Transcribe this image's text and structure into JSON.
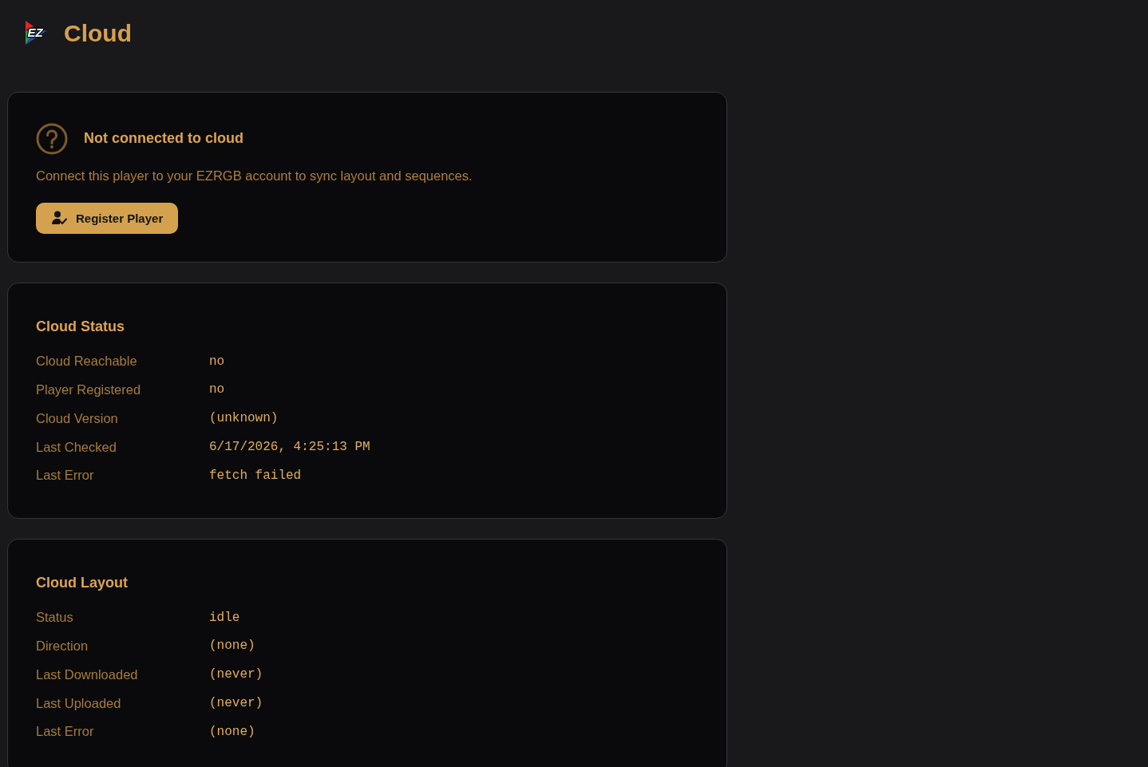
{
  "header": {
    "logo_text": "EZ",
    "title": "Cloud"
  },
  "connection_card": {
    "title": "Not connected to cloud",
    "description": "Connect this player to your EZRGB account to sync layout and sequences.",
    "button": "Register Player"
  },
  "sections": [
    {
      "title": "Cloud Status",
      "rows": [
        {
          "label": "Cloud Reachable",
          "value": "no"
        },
        {
          "label": "Player Registered",
          "value": "no"
        },
        {
          "label": "Cloud Version",
          "value": "(unknown)"
        },
        {
          "label": "Last Checked",
          "value": "6/17/2026, 4:25:13 PM"
        },
        {
          "label": "Last Error",
          "value": "fetch failed"
        }
      ]
    },
    {
      "title": "Cloud Layout",
      "rows": [
        {
          "label": "Status",
          "value": "idle"
        },
        {
          "label": "Direction",
          "value": "(none)"
        },
        {
          "label": "Last Downloaded",
          "value": "(never)"
        },
        {
          "label": "Last Uploaded",
          "value": "(never)"
        },
        {
          "label": "Last Error",
          "value": "(none)"
        }
      ]
    }
  ]
}
